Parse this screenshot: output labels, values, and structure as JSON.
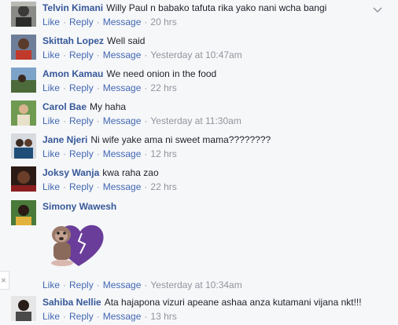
{
  "actions": {
    "like": "Like",
    "reply": "Reply",
    "message": "Message",
    "sep": "·"
  },
  "comments": [
    {
      "author": "Telvin Kimani",
      "text": "Willy Paul n babako tafuta rika yako nani wcha bangi",
      "time": "20 hrs"
    },
    {
      "author": "Skittah Lopez",
      "text": "Well said",
      "time": "Yesterday at 10:47am"
    },
    {
      "author": "Amon Kamau",
      "text": "We need onion in the food",
      "time": "22 hrs"
    },
    {
      "author": "Carol Bae",
      "text": "My haha",
      "time": "Yesterday at 11:30am"
    },
    {
      "author": "Jane Njeri",
      "text": "Ni wife yake ama ni sweet mama????????",
      "time": "12 hrs"
    },
    {
      "author": "Joksy Wanja",
      "text": "kwa raha zao",
      "time": "22 hrs"
    },
    {
      "author": "Simony Wawesh",
      "text": "",
      "time": "Yesterday at 10:34am"
    },
    {
      "author": "Sahiba Nellie",
      "text": "Ata hajapona vizuri apeane ashaa anza kutamani vijana nkt!!!",
      "time": "13 hrs"
    }
  ],
  "close_glyph": "×",
  "colors": {
    "link": "#4267b2",
    "author": "#365899",
    "meta": "#90949c",
    "background": "#f6f7f9"
  },
  "icons": {
    "options": "chevron-down-icon",
    "sticker": "broken-heart-sticker"
  }
}
